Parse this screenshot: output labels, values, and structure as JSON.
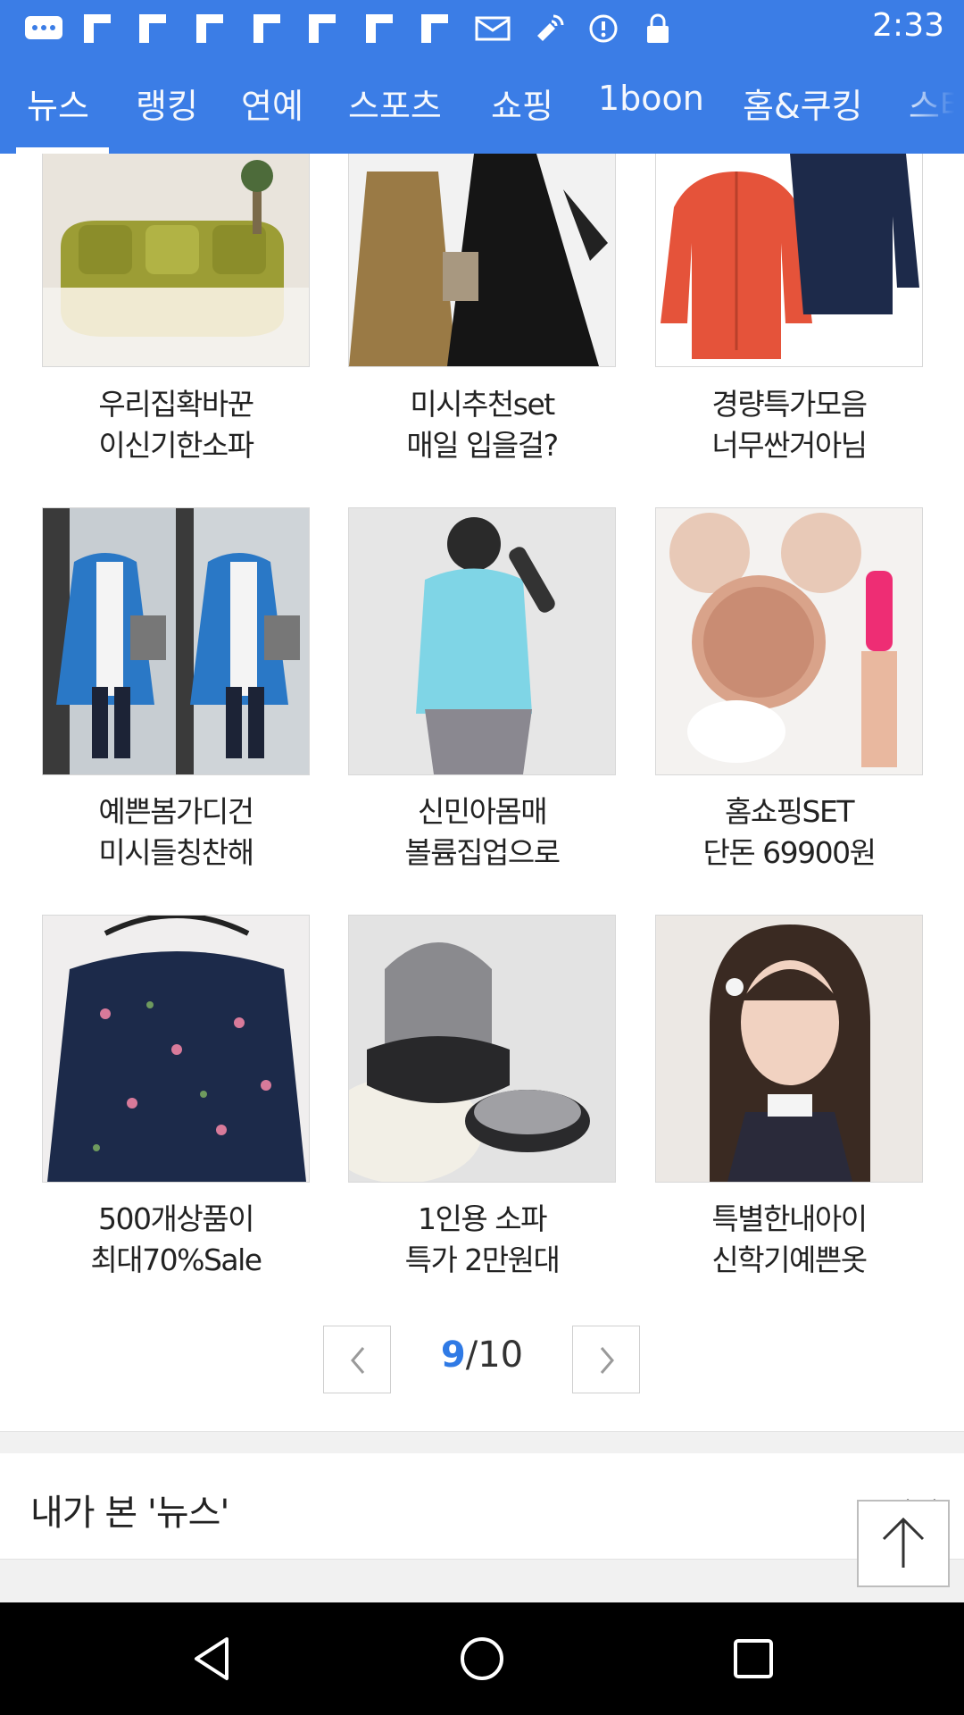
{
  "status_bar": {
    "time": "2:33",
    "icons": [
      "chat-icon",
      "flipboard-icon",
      "flipboard-icon",
      "flipboard-icon",
      "flipboard-icon",
      "flipboard-icon",
      "flipboard-icon",
      "mail-icon",
      "satellite-icon",
      "sync-icon",
      "lock-icon"
    ]
  },
  "tabs": [
    {
      "label": "뉴스",
      "active": true
    },
    {
      "label": "랭킹"
    },
    {
      "label": "연예"
    },
    {
      "label": "스포츠"
    },
    {
      "label": "쇼핑"
    },
    {
      "label": "1boon"
    },
    {
      "label": "홈&쿠킹"
    },
    {
      "label": "스타"
    }
  ],
  "products": [
    {
      "line1": "우리집확바꾼",
      "line2": "이신기한소파"
    },
    {
      "line1": "미시추천set",
      "line2": "매일 입을걸?"
    },
    {
      "line1": "경량특가모음",
      "line2": "너무싼거아님"
    },
    {
      "line1": "예쁜봄가디건",
      "line2": "미시들칭찬해"
    },
    {
      "line1": "신민아몸매",
      "line2": "볼륨집업으로"
    },
    {
      "line1": "홈쇼핑SET",
      "line2": "단돈 69900원"
    },
    {
      "line1": "500개상품이",
      "line2": "최대70%Sale"
    },
    {
      "line1": "1인용 소파",
      "line2": "특가 2만원대"
    },
    {
      "line1": "특별한내아이",
      "line2": "신학기예쁜옷"
    }
  ],
  "pager": {
    "current": "9",
    "separator": "/",
    "total": "10"
  },
  "history": {
    "title": "내가 본 '뉴스'"
  },
  "colors": {
    "accent": "#3b7de6",
    "page_current": "#2f7ae5"
  }
}
